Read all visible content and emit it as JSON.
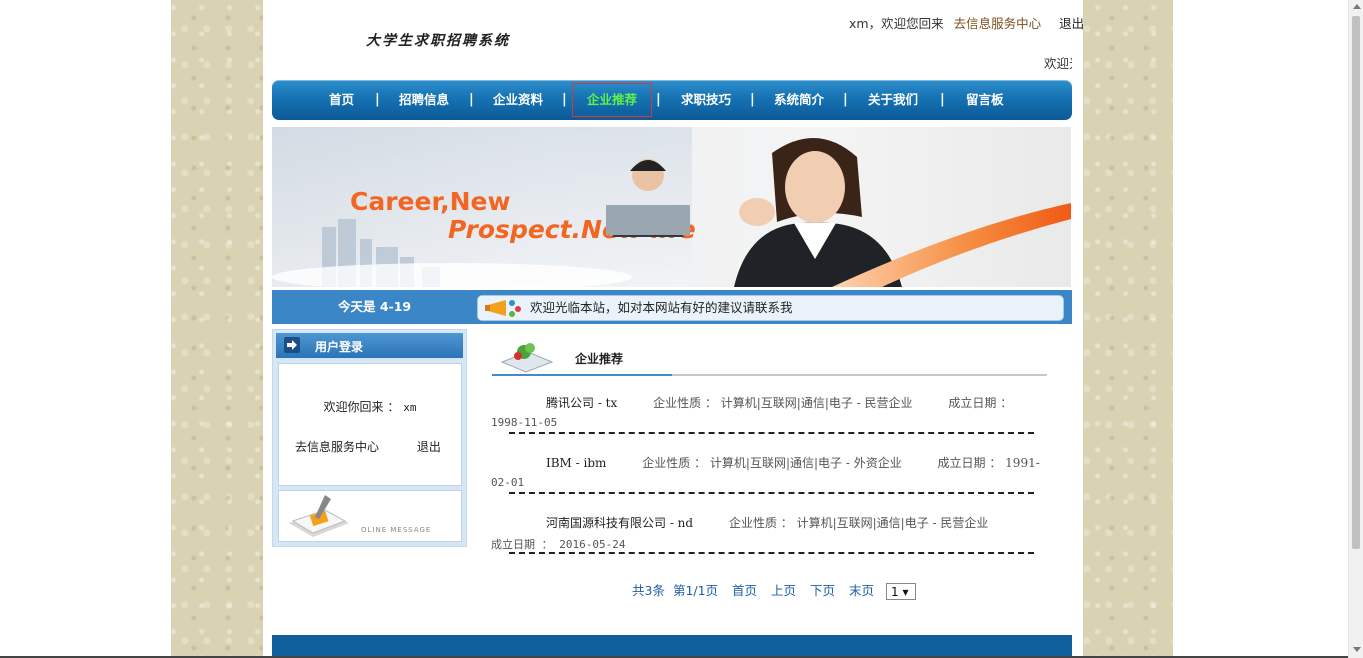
{
  "header": {
    "site_title": "大学生求职招聘系统",
    "user_greeting": "xm，欢迎您回来",
    "service_center_link": "去信息服务中心",
    "logout_link": "退出",
    "marquee_text": "欢迎光临本站"
  },
  "nav": {
    "items": [
      {
        "label": "首页"
      },
      {
        "label": "招聘信息"
      },
      {
        "label": "企业资料"
      },
      {
        "label": "企业推荐"
      },
      {
        "label": "求职技巧"
      },
      {
        "label": "系统简介"
      },
      {
        "label": "关于我们"
      },
      {
        "label": "留言板"
      }
    ],
    "separator": "|",
    "active_color": "#5ef14a",
    "bar_color": "#1672b3"
  },
  "banner": {
    "line1": "Career,New",
    "line2": "Prospect.New life",
    "accent_color": "#f26522"
  },
  "info_bar": {
    "today_label": "今天是 4-19",
    "notice_text": "欢迎光临本站，如对本网站有好的建议请联系我"
  },
  "login_panel": {
    "title": "用户登录",
    "welcome_prefix": "欢迎你回来 ：",
    "username": "xm",
    "service_center_link": "去信息服务中心",
    "logout_link": "退出",
    "message_label": "OLINE MESSAGE"
  },
  "main": {
    "section_title": "企业推荐",
    "companies": [
      {
        "name": "腾讯公司 - tx",
        "nature": "企业性质 ： 计算机|互联网|通信|电子 - 民营企业",
        "founded_label": "成立日期 ：",
        "founded_date": "1998-11-05"
      },
      {
        "name": "IBM - ibm",
        "nature": "企业性质 ： 计算机|互联网|通信|电子 - 外资企业",
        "founded_label": "成立日期 ： 1991-",
        "founded_date": "02-01"
      },
      {
        "name": "河南国源科技有限公司 - nd",
        "nature": "企业性质 ： 计算机|互联网|通信|电子 - 民营企业",
        "founded_label": "",
        "founded_date": "成立日期 ： 2016-05-24"
      }
    ],
    "pager": {
      "total": "共3条",
      "page_info": "第1/1页",
      "first": "首页",
      "prev": "上页",
      "next": "下页",
      "last": "末页",
      "current": "1 ▾"
    }
  }
}
